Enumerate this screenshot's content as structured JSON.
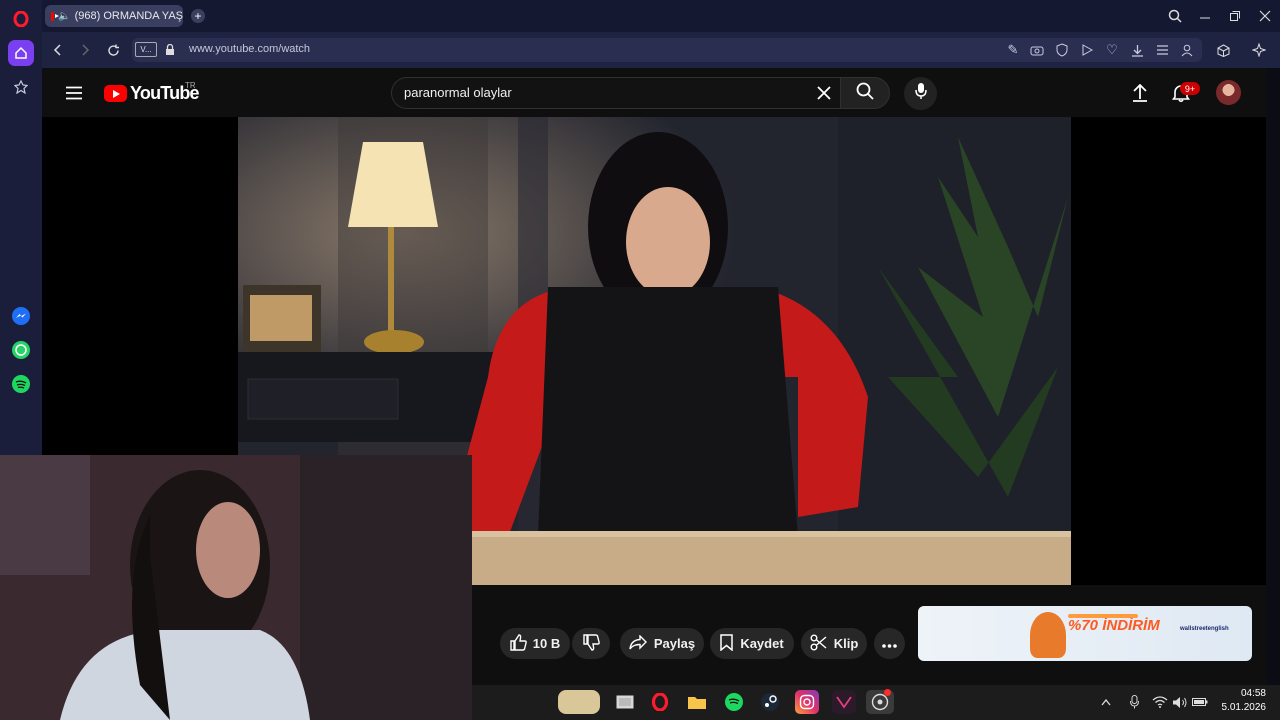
{
  "browser": {
    "tab_title": "(968) ORMANDA YAŞ",
    "address_badge": "V...",
    "url": "www.youtube.com/watch"
  },
  "youtube": {
    "logo_text": "YouTube",
    "region_code": "TR",
    "search_value": "paranormal olaylar",
    "notification_count": "9+"
  },
  "actions": {
    "like_count": "10 B",
    "share_label": "Paylaş",
    "save_label": "Kaydet",
    "clip_label": "Klip"
  },
  "ad": {
    "discount_text": "%70 İNDİRİM",
    "brand_text": "wallstreetenglish"
  },
  "taskbar": {
    "time": "04:58",
    "date": "5.01.2026"
  },
  "colors": {
    "youtube_red": "#ff0000",
    "opera_red": "#ff1b2d",
    "opera_sidebar": "#1b1e3a",
    "accent_purple": "#7b3ff2"
  }
}
